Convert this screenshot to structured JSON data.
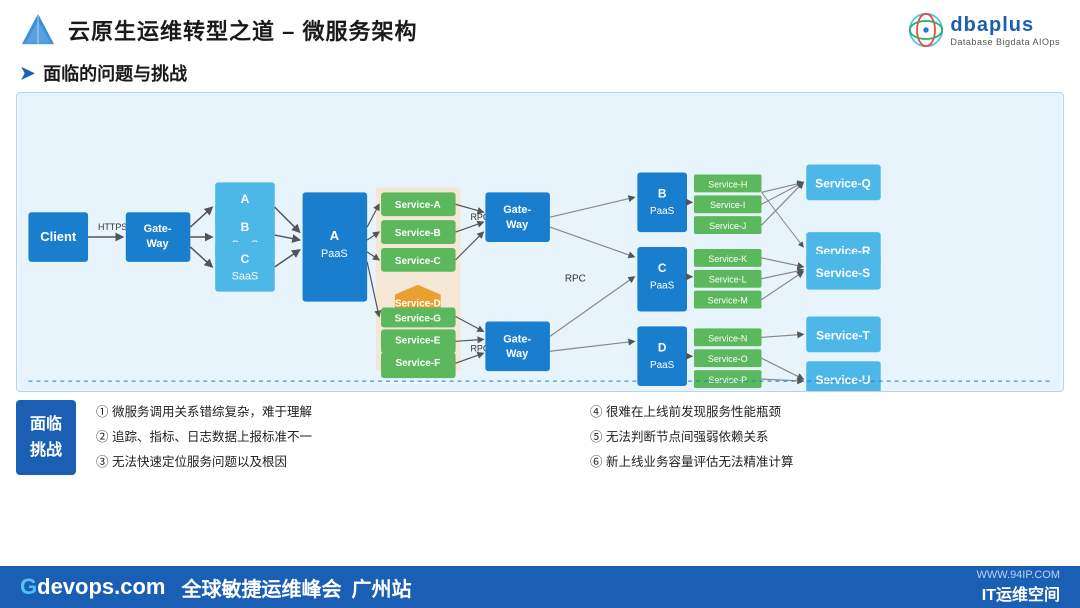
{
  "header": {
    "title": "云原生运维转型之道 – 微服务架构",
    "dbaplus": {
      "name": "dbaplus",
      "subtitle": "Database Bigdata AIOps"
    }
  },
  "section": {
    "title": "面临的问题与挑战"
  },
  "diagram": {
    "nodes": {
      "client": "Client",
      "gateway1": "Gate-Way",
      "a_saas": "A\nSaaS",
      "b_saas": "B\nSaaS",
      "c_saas": "C\nSaaS",
      "a_paas": "A\nPaaS",
      "service_a": "Service-A",
      "service_b": "Service-B",
      "service_c": "Service-C",
      "service_d": "Service-D",
      "service_e": "Service-E",
      "service_f": "Service-F",
      "service_g": "Service-G",
      "gateway2": "Gate-Way",
      "gateway3": "Gate-Way",
      "b_paas": "B\nPaaS",
      "c_paas": "C\nPaaS",
      "d_paas": "D\nPaaS",
      "service_h": "Service-H",
      "service_i": "Service-I",
      "service_j": "Service-J",
      "service_k": "Service-K",
      "service_l": "Service-L",
      "service_m": "Service-M",
      "service_n": "Service-N",
      "service_o": "Service 0",
      "service_p": "Service-P",
      "service_q": "Service-Q",
      "service_r": "Service-R",
      "service_s": "Service-S",
      "service_t": "Service-T",
      "service_u": "Service-U"
    },
    "labels": {
      "https": "HTTPS",
      "rpc1": "RPC",
      "rpc2": "RPC",
      "rpc3": "RPC"
    }
  },
  "challenges": {
    "badge_line1": "面临",
    "badge_line2": "挑战",
    "left": [
      "① 微服务调用关系错综复杂，难于理解",
      "② 追踪、指标、日志数据上报标准不一",
      "③ 无法快速定位服务问题以及根因"
    ],
    "right": [
      "④ 很难在上线前发现服务性能瓶颈",
      "⑤ 无法判断节点间强弱依赖关系",
      "⑥ 新上线业务容量评估无法精准计算"
    ]
  },
  "footer": {
    "gdevops": "Gdevops.com",
    "summit": "全球敏捷运维峰会",
    "city": "广州站",
    "url": "WWW.94IP.COM",
    "brand": "IT运维空间"
  }
}
